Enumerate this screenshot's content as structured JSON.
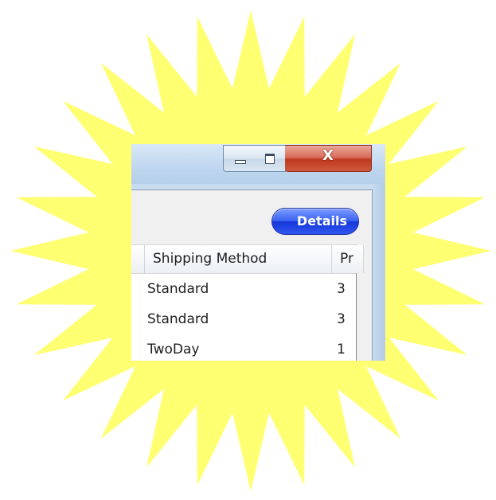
{
  "window": {
    "caption_buttons": {
      "minimize_icon": "minimize-icon",
      "maximize_icon": "maximize-icon",
      "close_icon": "close-icon",
      "close_glyph": "X"
    }
  },
  "toolbar": {
    "details_label": "Details"
  },
  "grid": {
    "columns": [
      "Shipping Method",
      "Pr"
    ],
    "rows": [
      {
        "shipping_method": "Standard",
        "p": "3"
      },
      {
        "shipping_method": "Standard",
        "p": "3"
      },
      {
        "shipping_method": "TwoDay",
        "p": "1"
      }
    ]
  },
  "colors": {
    "highlight_burst": "#ffff72",
    "details_button": "#2f57ef",
    "close_button": "#c0391f"
  }
}
